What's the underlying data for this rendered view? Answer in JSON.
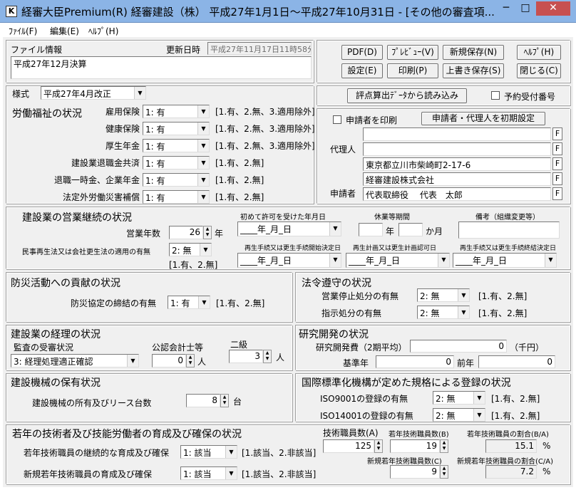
{
  "window": {
    "title": "経審大臣Premium(R)  経審建設（株）   平成27年1月1日～平成27年10月31日 - [その他の審査項...",
    "minimize": "─",
    "maximize": "□",
    "close": "✕",
    "icon": "window-app-icon"
  },
  "menu": [
    "ﾌｧｲﾙ(F)",
    "編集(E)",
    "ﾍﾙﾌﾟ(H)"
  ],
  "fileinfo": {
    "label": "ファイル情報",
    "updated_label": "更新日時",
    "updated_value": "平成27年11月17日11時58分",
    "memo": "平成27年12月決算"
  },
  "toolbar": {
    "pdf": "PDF(D)",
    "preview": "ﾌﾟﾚﾋﾞｭｰ(V)",
    "save_new": "新規保存(N)",
    "help": "ﾍﾙﾌﾟ(H)",
    "settings": "設定(E)",
    "print": "印刷(P)",
    "overwrite": "上書き保存(S)",
    "close": "閉じる(C)"
  },
  "style": {
    "label": "様式",
    "value": "平成27年4月改正"
  },
  "import": {
    "button": "評点算出ﾃﾞｰﾀから読み込み",
    "reservation": "予約受付番号"
  },
  "labor": {
    "heading": "労働福祉の状況",
    "rows": [
      {
        "label": "雇用保険",
        "value": "1: 有",
        "hint": "[1.有、2.無、3.適用除外]"
      },
      {
        "label": "健康保険",
        "value": "1: 有",
        "hint": "[1.有、2.無、3.適用除外]"
      },
      {
        "label": "厚生年金",
        "value": "1: 有",
        "hint": "[1.有、2.無、3.適用除外]"
      },
      {
        "label": "建設業退職金共済",
        "value": "1: 有",
        "hint": "[1.有、2.無]"
      },
      {
        "label": "退職一時金、企業年金",
        "value": "1: 有",
        "hint": "[1.有、2.無]"
      },
      {
        "label": "法定外労働災害補償",
        "value": "1: 有",
        "hint": "[1.有、2.無]"
      }
    ]
  },
  "applicant": {
    "print_label": "申請者を印刷",
    "init_button": "申請者・代理人を初期設定",
    "agent_label": "代理人",
    "applicant_label": "申請者",
    "f": "F",
    "lines": [
      "",
      "",
      "東京都立川市柴崎町2-17-6",
      "経審建設株式会社",
      "代表取締役　 代表　太郎"
    ]
  },
  "business": {
    "heading": "建設業の営業継続の状況",
    "years_label": "営業年数",
    "years_value": "26",
    "years_unit": "年",
    "civil_label": "民事再生法又は会社更生法の適用の有無",
    "civil_value": "2: 無",
    "civil_hint": "[1.有、2.無]",
    "first_permit": "初めて許可を受けた年月日",
    "suspend": "休業等期間",
    "remarks": "備考（組織変更等）",
    "date_ph": "____年_月_日",
    "year_unit": "年",
    "month_unit": "か月",
    "civil1": "再生手続又は更生手続開始決定日",
    "civil2": "再生計画又は更生計画認可日",
    "civil3": "再生手続又は更生手続終結決定日"
  },
  "disaster": {
    "heading": "防災活動への貢献の状況",
    "label": "防災協定の締結の有無",
    "value": "1: 有",
    "hint": "[1.有、2.無]"
  },
  "law": {
    "heading": "法令遵守の状況",
    "rows": [
      {
        "label": "営業停止処分の有無",
        "value": "2: 無",
        "hint": "[1.有、2.無]"
      },
      {
        "label": "指示処分の有無",
        "value": "2: 無",
        "hint": "[1.有、2.無]"
      }
    ]
  },
  "accounting": {
    "heading": "建設業の経理の状況",
    "audit_label": "監査の受審状況",
    "audit_value": "3: 経理処理適正確認",
    "cpa_label": "公認会計士等",
    "cpa_value": "0",
    "cpa_unit": "人",
    "grade2_label": "二級",
    "grade2_value": "3",
    "grade2_unit": "人"
  },
  "research": {
    "heading": "研究開発の状況",
    "avg_label": "研究開発費（2期平均）",
    "avg_value": "0",
    "avg_unit": "（千円）",
    "base_label": "基準年",
    "base_value": "0",
    "prev_label": "前年",
    "prev_value": "0"
  },
  "machinery": {
    "heading": "建設機械の保有状況",
    "label": "建設機械の所有及びリース台数",
    "value": "8",
    "unit": "台"
  },
  "iso": {
    "heading": "国際標準化機構が定めた規格による登録の状況",
    "rows": [
      {
        "label": "ISO9001の登録の有無",
        "value": "2: 無",
        "hint": "[1.有、2.無]"
      },
      {
        "label": "ISO14001の登録の有無",
        "value": "2: 無",
        "hint": "[1.有、2.無]"
      }
    ]
  },
  "young": {
    "heading": "若年の技術者及び技能労働者の育成及び確保の状況",
    "cont_label": "若年技術職員の継続的な育成及び確保",
    "cont_value": "1: 該当",
    "cont_hint": "[1.該当、2.非該当]",
    "new_label": "新規若年技術職員の育成及び確保",
    "new_value": "1: 該当",
    "new_hint": "[1.該当、2.非該当]",
    "techA_label": "技術職員数(A)",
    "techA_value": "125",
    "youngB_label": "若年技術職員数(B)",
    "youngB_value": "19",
    "ratioBA_label": "若年技術職員の割合(B/A)",
    "ratioBA_value": "15.1",
    "pct": "%",
    "newC_label": "新規若年技術職員数(C)",
    "newC_value": "9",
    "ratioCA_label": "新規若年技術職員の割合(C/A)",
    "ratioCA_value": "7.2"
  },
  "arrow": "▼",
  "spin_up": "▲",
  "spin_down": "▼"
}
